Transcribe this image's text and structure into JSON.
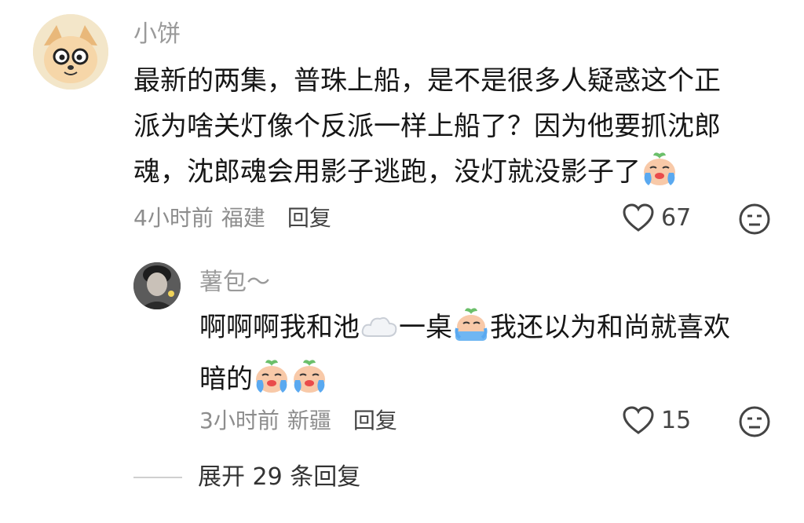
{
  "comment1": {
    "username": "小饼",
    "text_line1": "最新的两集，普珠上船，是不是很多人疑惑这个正",
    "text_line2": "派为啥关灯像个反派一样上船了？因为他要抓沈郎",
    "text_line3": "魂，沈郎魂会用影子逃跑，没灯就没影子了",
    "time": "4小时前",
    "location": "福建",
    "reply_label": "回复",
    "likes": "67"
  },
  "comment2": {
    "username": "薯包～",
    "text_part1": "啊啊啊我和池",
    "text_part2": "一桌",
    "text_part3": "我还以为和尚就喜欢",
    "text_line2": "暗的",
    "time": "3小时前",
    "location": "新疆",
    "reply_label": "回复",
    "likes": "15"
  },
  "expand_label": "展开 29 条回复",
  "icons": [
    "heart-icon",
    "dislike-face-icon",
    "crying-emoji",
    "cloud-emoji"
  ],
  "colors": {
    "text": "#161616",
    "muted": "#8d8d8d",
    "username": "#9a9a9a"
  }
}
